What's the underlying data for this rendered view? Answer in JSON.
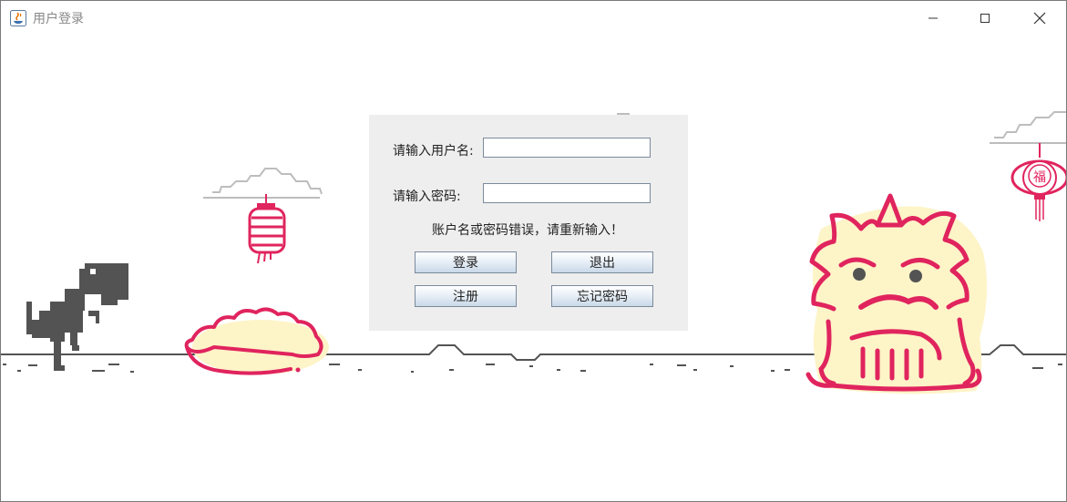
{
  "window": {
    "title": "用户登录",
    "controls": {
      "minimize": "minimize",
      "maximize": "maximize",
      "close": "close"
    }
  },
  "form": {
    "username_label": "请输入用户名:",
    "username_value": "",
    "password_label": "请输入密码:",
    "password_value": "",
    "error_message": "账户名或密码错误，请重新输入！",
    "login_button": "登录",
    "exit_button": "退出",
    "register_button": "注册",
    "forgot_button": "忘记密码"
  },
  "decorations": {
    "lantern_char": "福",
    "icons": [
      "java-icon",
      "dinosaur-icon",
      "cloud-icon",
      "lantern-icon",
      "dumpling-icon",
      "lion-dance-icon"
    ]
  },
  "colors": {
    "accent_red": "#e0245e",
    "cream": "#fdf4c8",
    "dino_gray": "#535353",
    "panel_bg": "#eeeeee"
  }
}
